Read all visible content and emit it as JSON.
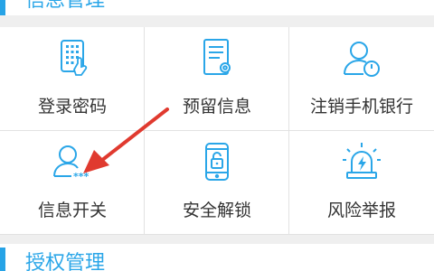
{
  "colors": {
    "accent": "#27a3e6",
    "icon": "#2aa6e8",
    "label": "#333333",
    "arrow": "#e03a2f"
  },
  "sections": {
    "info_management": {
      "title": "信息管理"
    },
    "auth_management": {
      "title": "授权管理"
    }
  },
  "grid": [
    {
      "label": "登录密码",
      "icon": "keypad-icon"
    },
    {
      "label": "预留信息",
      "icon": "document-gear-icon"
    },
    {
      "label": "注销手机银行",
      "icon": "user-power-icon"
    },
    {
      "label": "信息开关",
      "icon": "user-asterisk-icon"
    },
    {
      "label": "安全解锁",
      "icon": "phone-lock-icon"
    },
    {
      "label": "风险举报",
      "icon": "alarm-light-icon"
    }
  ]
}
